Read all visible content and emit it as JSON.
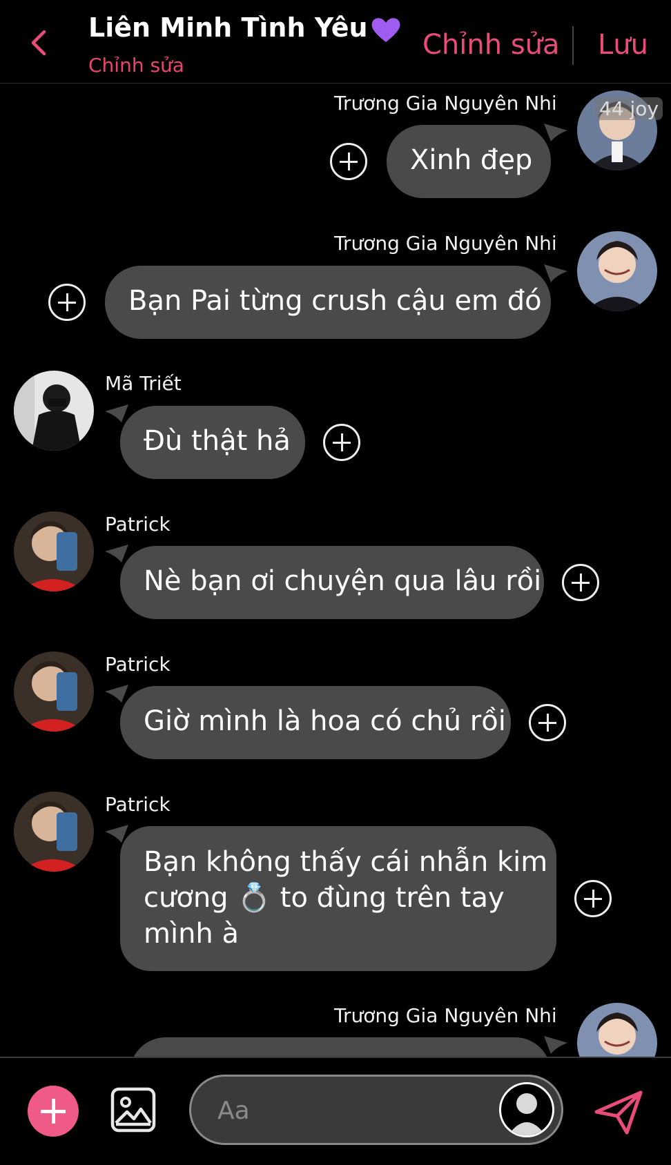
{
  "header": {
    "title": "Liên Minh Tình Yêu",
    "subtitle": "Chỉnh sửa",
    "edit_label": "Chỉnh sửa",
    "save_label": "Lưu",
    "accent": "#ea4c79",
    "heart_color": "#a05cf0"
  },
  "watermark": "44 joy",
  "messages": [
    {
      "sender": "Trương Gia Nguyên Nhi",
      "text": "Xinh đẹp",
      "side": "right"
    },
    {
      "sender": "Trương Gia Nguyên Nhi",
      "text": "Bạn Pai từng crush cậu em đó",
      "side": "right"
    },
    {
      "sender": "Mã Triết",
      "text": "Đù thật hả",
      "side": "left"
    },
    {
      "sender": "Patrick",
      "text": "Nè bạn ơi chuyện qua lâu rồi",
      "side": "left"
    },
    {
      "sender": "Patrick",
      "text": "Giờ mình là hoa có chủ rồi",
      "side": "left"
    },
    {
      "sender": "Patrick",
      "lines": [
        "Bạn không thấy cái nhẫn kim",
        "cương 💍 to đùng trên tay",
        "mình à"
      ],
      "side": "left"
    },
    {
      "sender": "Trương Gia Nguyên Nhi",
      "text": "",
      "side": "right"
    }
  ],
  "composer": {
    "placeholder": "Aa"
  },
  "colors": {
    "bubble": "#4a4a4a",
    "background": "#000000",
    "add_button": "#ef5a86"
  },
  "icons": [
    "back-chevron-icon",
    "purple-heart-icon",
    "add-circle-icon",
    "image-icon",
    "send-icon",
    "user-silhouette-icon"
  ]
}
